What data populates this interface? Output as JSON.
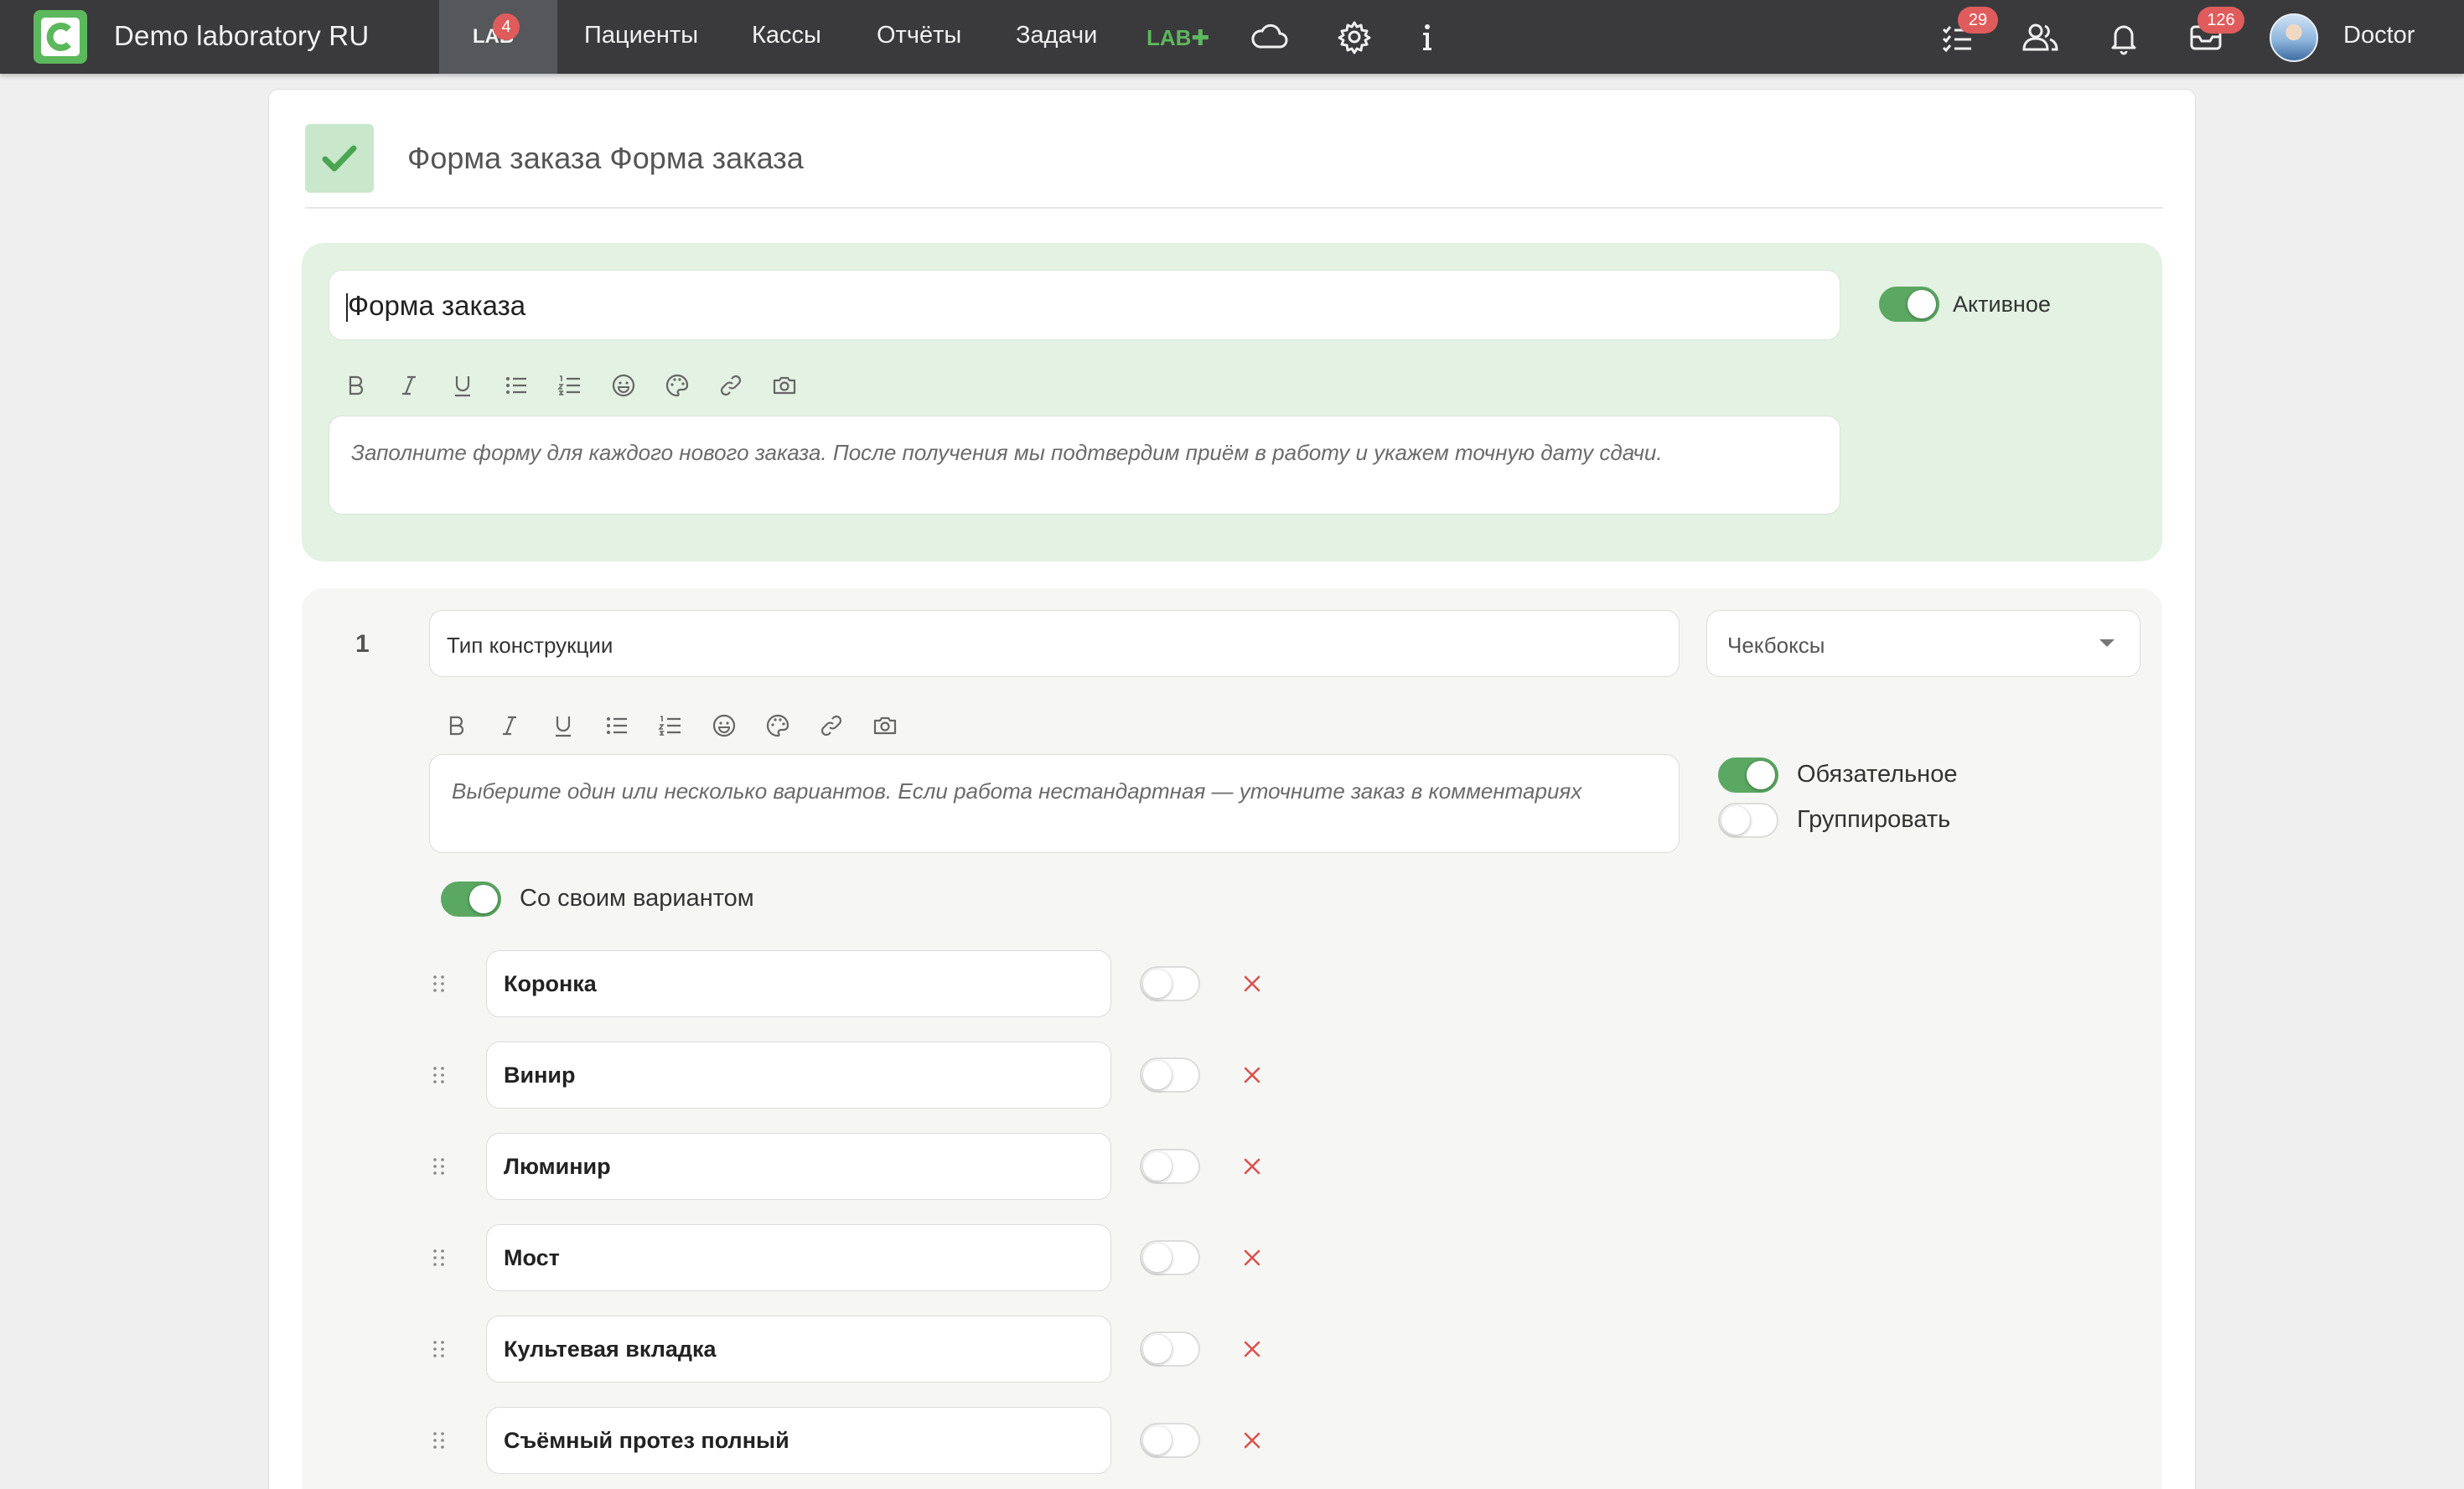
{
  "navbar": {
    "app_title": "Demo laboratory RU",
    "lab_tab": {
      "label": "LAB",
      "badge": "4"
    },
    "links": [
      "Пациенты",
      "Кассы",
      "Отчёты",
      "Задачи"
    ],
    "lab_plus": "LAB✚",
    "tasks_badge": "29",
    "messages_badge": "126",
    "user_name": "Doctor",
    "icons": [
      "cloud-icon",
      "gear-icon",
      "info-icon",
      "tasks-icon",
      "users-icon",
      "bell-icon",
      "mail-icon"
    ]
  },
  "form_header": {
    "title": "Форма заказа Форма заказа"
  },
  "form": {
    "title_value": "Форма заказа",
    "description": "Заполните форму для каждого нового заказа. После получения мы подтвердим приём в работу и укажем точную дату сдачи.",
    "active_label": "Активное",
    "active": true
  },
  "question": {
    "number": "1",
    "title": "Тип конструкции",
    "type": "Чекбоксы",
    "description": "Выберите один или несколько вариантов. Если работа нестандартная — уточните заказ в комментариях",
    "required_label": "Обязательное",
    "required": true,
    "group_label": "Группировать",
    "group": false,
    "custom_option_label": "Со своим вариантом",
    "custom_option": true,
    "options": [
      {
        "label": "Коронка",
        "enabled": false
      },
      {
        "label": "Винир",
        "enabled": false
      },
      {
        "label": "Люминир",
        "enabled": false
      },
      {
        "label": "Мост",
        "enabled": false
      },
      {
        "label": "Культевая вкладка",
        "enabled": false
      },
      {
        "label": "Съёмный протез полный",
        "enabled": false
      }
    ]
  },
  "colors": {
    "navbar_bg": "#3a3a3d",
    "brand_green": "#5cb85c",
    "toggle_on": "#5ba862",
    "badge_red": "#e05c5c",
    "remove_red": "#d9534f"
  }
}
